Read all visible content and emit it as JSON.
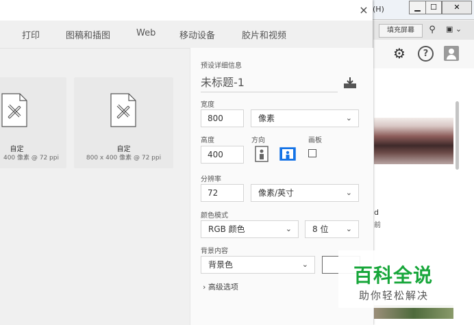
{
  "background_app": {
    "menu_help": "(H)",
    "minimize_label": "▁",
    "maximize_label": "☐",
    "close_label": "✕",
    "fill_screen_button": "填充屏幕",
    "side_text_d": "d",
    "side_text_qian": "前"
  },
  "dialog": {
    "close_label": "×",
    "tabs": [
      {
        "label": "打印"
      },
      {
        "label": "图稿和插图"
      },
      {
        "label": "Web"
      },
      {
        "label": "移动设备"
      },
      {
        "label": "胶片和视频"
      }
    ],
    "presets": [
      {
        "title": "自定",
        "subtitle": "400 像素 @ 72 ppi"
      },
      {
        "title": "自定",
        "subtitle": "800 x 400 像素 @ 72 ppi"
      }
    ]
  },
  "details": {
    "section_label": "预设详细信息",
    "document_name": "未标题-1",
    "width_label": "宽度",
    "width_value": "800",
    "width_unit": "像素",
    "height_label": "高度",
    "height_value": "400",
    "orientation_label": "方向",
    "artboard_label": "画板",
    "resolution_label": "分辨率",
    "resolution_value": "72",
    "resolution_unit": "像素/英寸",
    "color_mode_label": "颜色模式",
    "color_mode_value": "RGB 颜色",
    "bit_depth_value": "8 位",
    "background_label": "背景内容",
    "background_value": "背景色",
    "advanced_label": "高级选项",
    "chevron": "⌄",
    "advanced_chevron": "›"
  },
  "watermark": {
    "title": "百科全说",
    "subtitle": "助你轻松解决"
  },
  "colors": {
    "accent": "#1473e6",
    "watermark_green": "#17a63a"
  }
}
